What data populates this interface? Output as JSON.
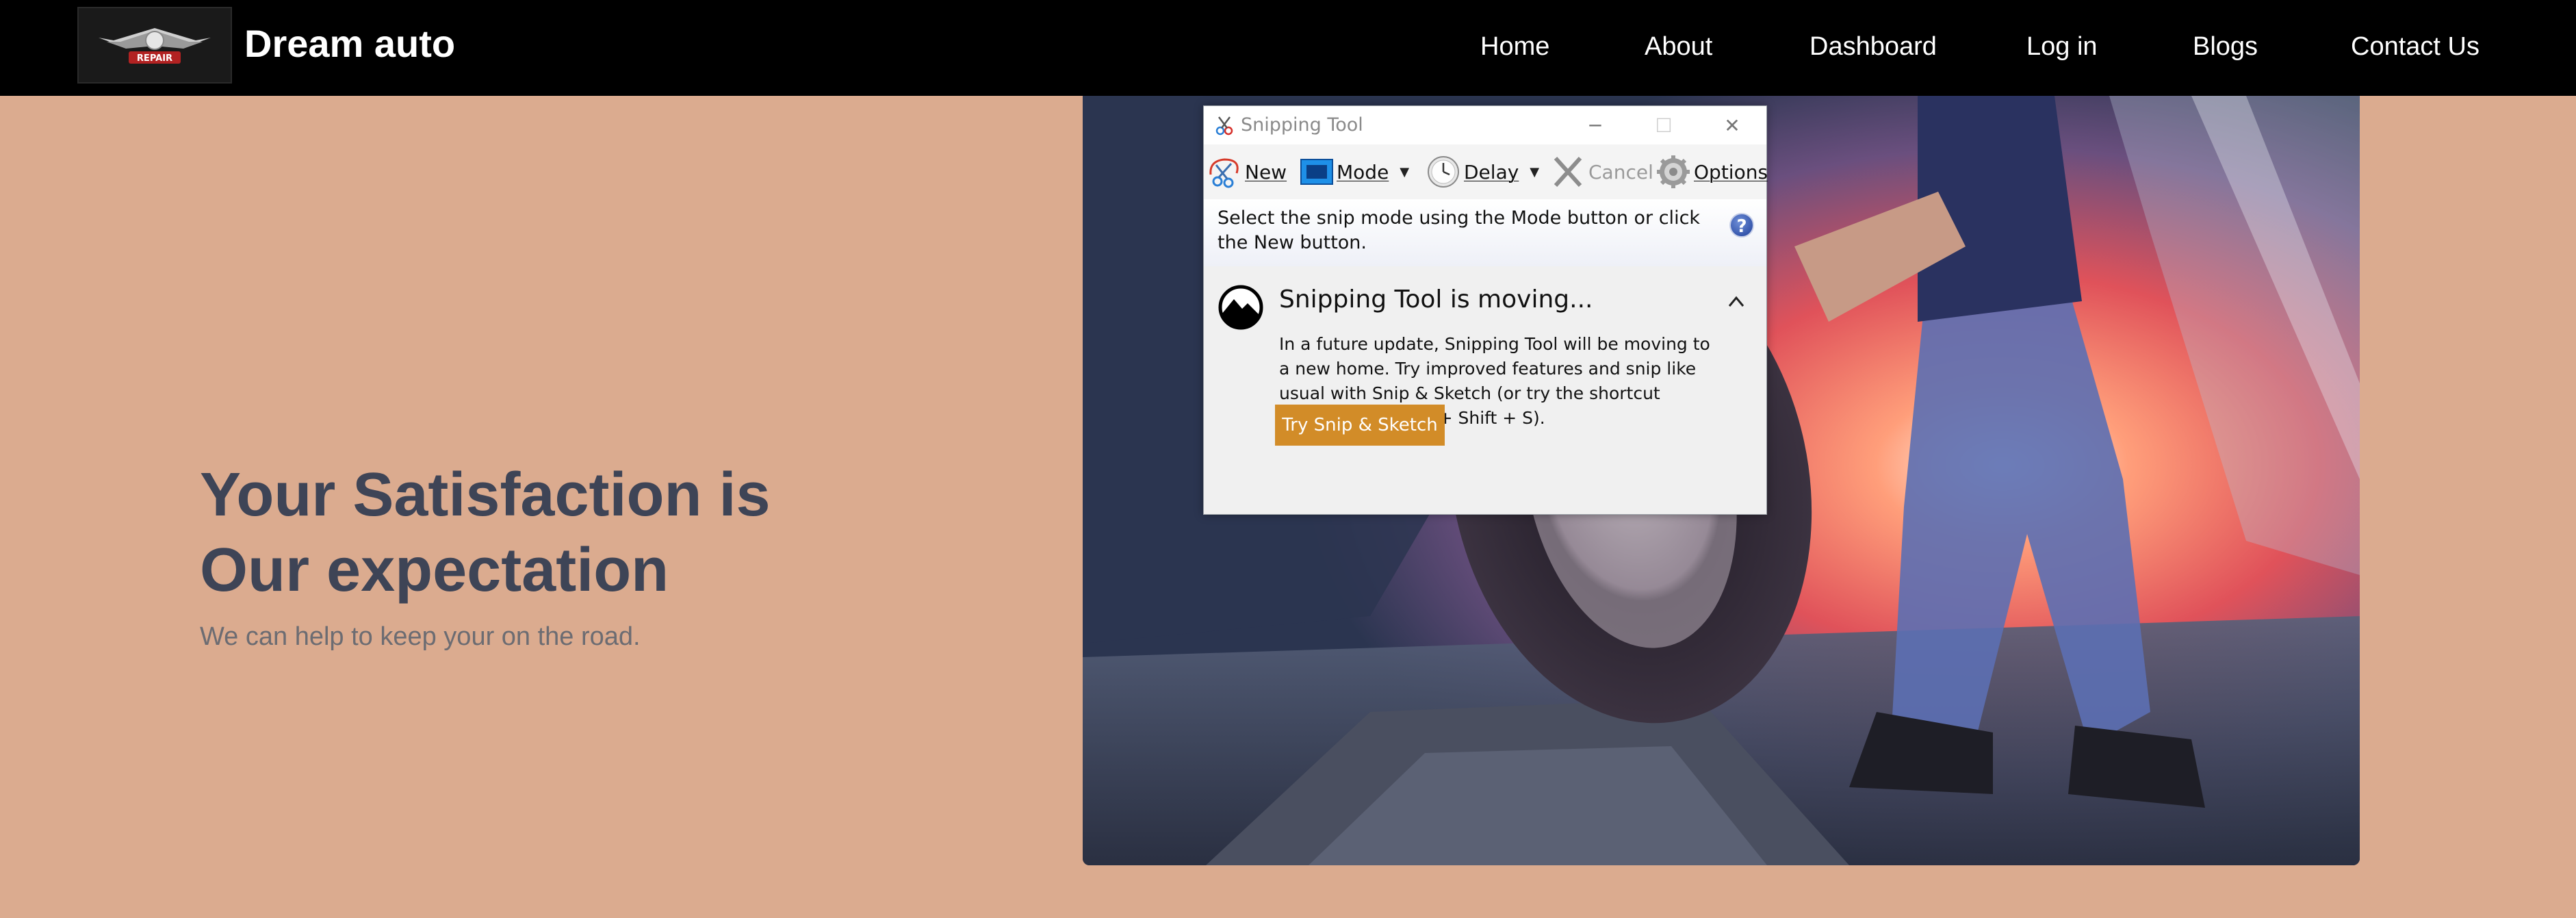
{
  "navbar": {
    "brand": "Dream auto",
    "logo_text": "REPAIR",
    "links": [
      "Home",
      "About",
      "Dashboard",
      "Log in",
      "Blogs",
      "Contact Us"
    ]
  },
  "hero": {
    "title_line1": "Your Satisfaction is",
    "title_line2": "Our expectation",
    "subtitle": "We can help to keep your on the road.",
    "photo_icon": "mechanic-tire-photo"
  },
  "snipping_tool": {
    "title": "Snipping Tool",
    "toolbar": {
      "new": "New",
      "mode": "Mode",
      "delay": "Delay",
      "cancel": "Cancel",
      "options": "Options"
    },
    "info": "Select the snip mode using the Mode button or click the New button.",
    "moving": {
      "title": "Snipping Tool is moving...",
      "body": "In a future update, Snipping Tool will be moving to a new home. Try improved features and snip like usual with Snip & Sketch (or try the shortcut Windows logo key + Shift + S).",
      "button": "Try Snip & Sketch"
    }
  },
  "colors": {
    "page_bg": "#dbab8f",
    "navbar_bg": "#000000",
    "title_color": "#3e4456",
    "accent_button": "#d28c28"
  }
}
